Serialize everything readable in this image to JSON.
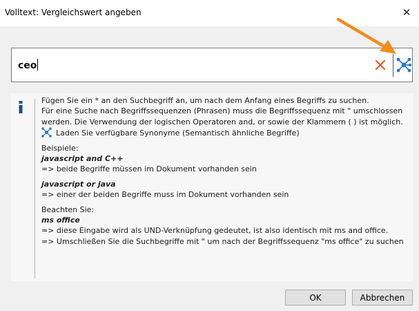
{
  "window": {
    "title": "Volltext: Vergleichswert angeben",
    "close_glyph": "✕"
  },
  "search": {
    "value": "ceo"
  },
  "icons": {
    "clear": "clear-x-icon",
    "synonym": "network-synonym-icon",
    "info": "info-icon",
    "annotation": "orange-arrow"
  },
  "colors": {
    "clear": "#e05a2b",
    "synonym": "#2f78c4",
    "arrow": "#f08c1e"
  },
  "help": {
    "lines": [
      "Fügen Sie ein * an den Suchbegriff an, um nach dem Anfang eines Begriffs zu suchen.",
      "Für eine Suche nach Begriffssequenzen (Phrasen) muss die Begriffssequenz mit \" umschlossen werden. Die Verwendung der logischen Operatoren and, or sowie der Klammern ( ) ist möglich."
    ],
    "synonym_hint": "Laden Sie verfügbare Synonyme (Semantisch ähnliche Begriffe)",
    "examples_heading": "Beispiele:",
    "example1": {
      "query": "javascript and C++",
      "result": "=> beide Begriffe müssen im Dokument vorhanden sein"
    },
    "example2": {
      "query": "javascript or java",
      "result": "=> einer der beiden Begriffe muss im Dokument vorhanden sein"
    },
    "note_heading": "Beachten Sie:",
    "note_query": "ms office",
    "note_lines": [
      "=> diese Eingabe wird als UND-Verknüpfung gedeutet, ist also identisch mit ms and office.",
      "=> Umschließen Sie die Suchbegriffe mit \" um nach der Begriffssequenz \"ms office\" zu suchen"
    ]
  },
  "buttons": {
    "ok": "OK",
    "cancel": "Abbrechen"
  }
}
